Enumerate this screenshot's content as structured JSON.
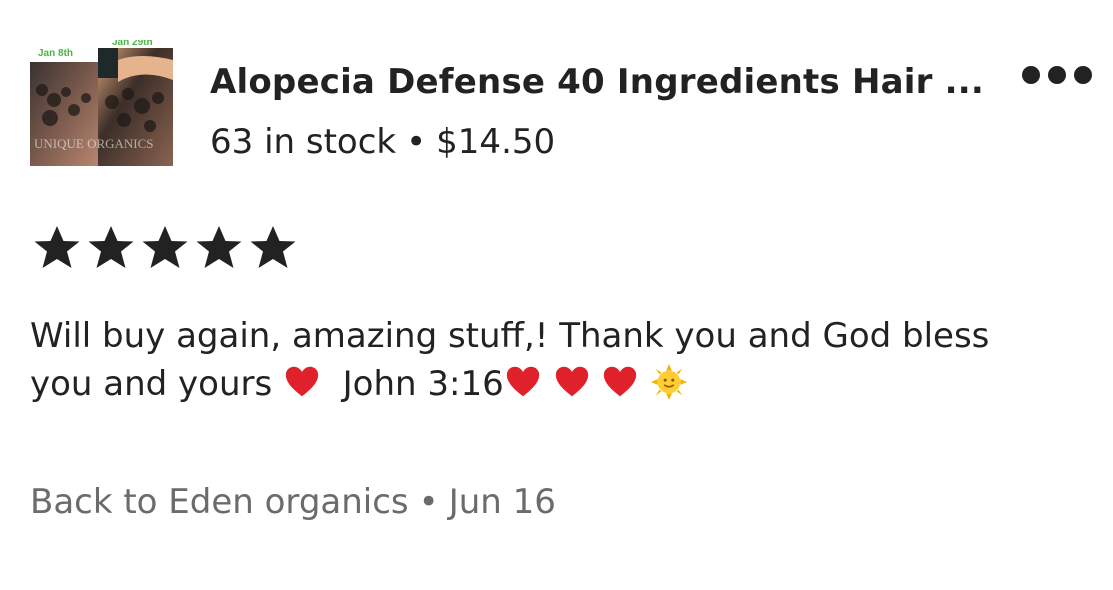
{
  "product": {
    "thumbnail": {
      "label_left": "Jan 8th",
      "label_right": "Jan 29th",
      "watermark": "UNIQUE ORGANICS"
    },
    "title": "Alopecia Defense 40 Ingredients  Hair ...",
    "stock": "63 in stock",
    "separator": "•",
    "price": "$14.50"
  },
  "rating": {
    "stars": 5,
    "max": 5
  },
  "review": {
    "line1": "Will buy again, amazing stuff,! Thank you and God bless",
    "line2_text": "you and yours",
    "line2_verse": "John 3:16",
    "emojis": [
      "heart-icon",
      "heart-icon",
      "heart-icon",
      "heart-icon",
      "sun-face-icon"
    ]
  },
  "meta": {
    "shop": "Back to Eden organics",
    "separator": "•",
    "date": "Jun 16"
  },
  "colors": {
    "text": "#222222",
    "muted": "#6b6b6b",
    "heart": "#e0202a",
    "sun": "#f6b400",
    "date_label": "#4bb543"
  }
}
